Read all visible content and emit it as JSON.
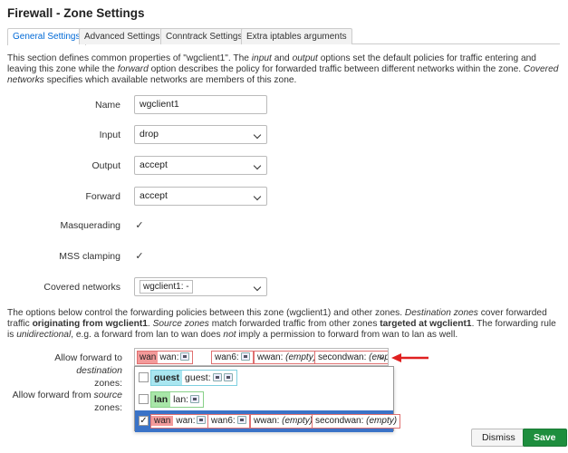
{
  "page": {
    "title": "Firewall - Zone Settings"
  },
  "tabs": [
    {
      "label": "General Settings",
      "active": true
    },
    {
      "label": "Advanced Settings"
    },
    {
      "label": "Conntrack Settings"
    },
    {
      "label": "Extra iptables arguments"
    }
  ],
  "intro": {
    "p1": "This section defines common properties of \"wgclient1\". The ",
    "input_word": "input",
    "p2": " and ",
    "output_word": "output",
    "p3": " options set the default policies for traffic entering and leaving this zone while the ",
    "forward_word": "forward",
    "p4": " option describes the policy for forwarded traffic between different networks within the zone. ",
    "covered_word": "Covered networks",
    "p5": " specifies which available networks are members of this zone."
  },
  "form": {
    "name": {
      "label": "Name",
      "value": "wgclient1"
    },
    "input": {
      "label": "Input",
      "value": "drop"
    },
    "output": {
      "label": "Output",
      "value": "accept"
    },
    "forward": {
      "label": "Forward",
      "value": "accept"
    },
    "masquerading": {
      "label": "Masquerading",
      "checked": true,
      "mark": "✓"
    },
    "mss": {
      "label": "MSS clamping",
      "checked": true,
      "mark": "✓"
    },
    "covered": {
      "label": "Covered networks",
      "value": "wgclient1: -"
    }
  },
  "forwarding": {
    "p1": "The options below control the forwarding policies between this zone (wgclient1) and other zones. ",
    "dest_word": "Destination zones",
    "p2": " cover forwarded traffic ",
    "orig_bold": "originating from wgclient1",
    "p3": ". ",
    "source_word": "Source zones",
    "p4": " match forwarded traffic from other zones ",
    "targeted_bold": "targeted at wgclient1",
    "p5": ". The forwarding rule is ",
    "unidirectional": "unidirectional",
    "p6": ", e.g. a forward from lan to wan does ",
    "not_word": "not",
    "p7": " imply a permission to forward from wan to lan as well."
  },
  "dest": {
    "label_a": "Allow forward to ",
    "label_b": "destination",
    "label_c": "zones:",
    "chips": {
      "zone": "wan",
      "wan": "wan:",
      "wan6": "wan6:",
      "wwan": "wwan:",
      "wwan_val": "(empty)",
      "secondwan": "secondwan:",
      "secondwan_val": "(empty,"
    }
  },
  "source": {
    "label_a": "Allow forward from ",
    "label_b": "source",
    "label_c": "zones:"
  },
  "menu": {
    "guest": {
      "zone": "guest",
      "net": "guest:",
      "checked": false
    },
    "lan": {
      "zone": "lan",
      "net": "lan:",
      "checked": false
    },
    "wan": {
      "zone": "wan",
      "checked": true,
      "mark": "✓",
      "wan": "wan:",
      "wan6": "wan6:",
      "wwan": "wwan:",
      "wwan_val": "(empty)",
      "secondwan": "secondwan:",
      "secondwan_val": "(empty)"
    }
  },
  "buttons": {
    "dismiss": "Dismiss",
    "save": "Save"
  },
  "colors": {
    "accent": "#0069d6",
    "save": "#1e8e3e",
    "wan_zone": "#f39a9a",
    "lan_zone": "#a8e6a8",
    "guest_zone": "#a9e6f0",
    "arrow": "#e02020",
    "selected": "#3a73c7"
  }
}
